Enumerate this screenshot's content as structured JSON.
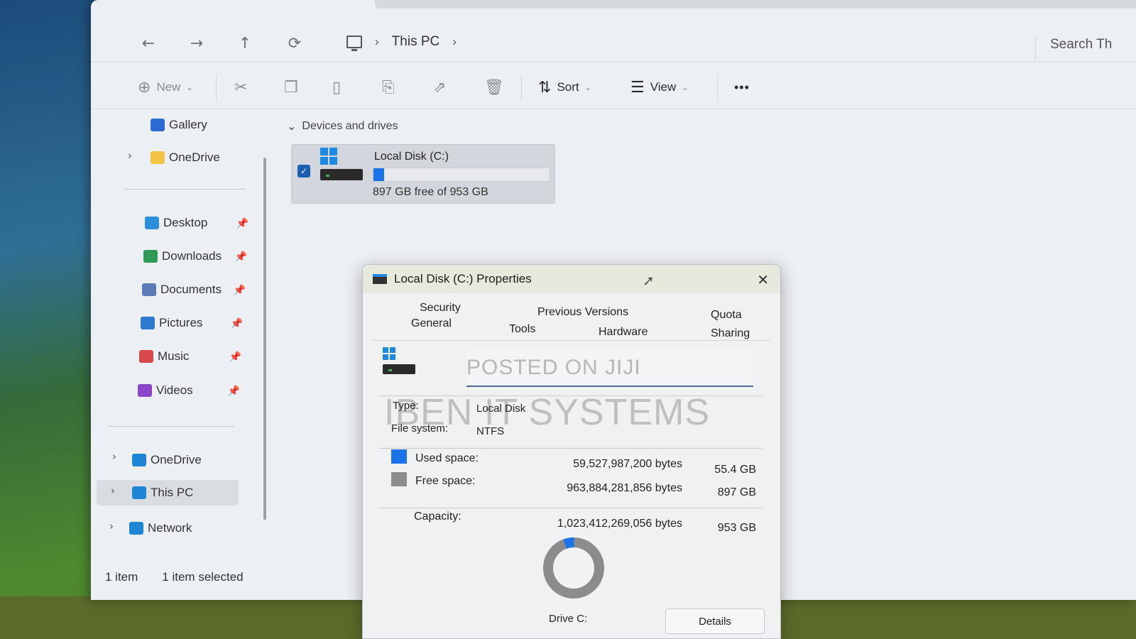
{
  "explorer": {
    "nav": {
      "back": "←",
      "forward": "→",
      "up": "↑",
      "refresh": "⟳"
    },
    "breadcrumb": [
      "This PC"
    ],
    "search_placeholder": "Search Th",
    "toolbar": {
      "new_label": "New",
      "sort_label": "Sort",
      "view_label": "View",
      "more_label": "•••"
    },
    "sidebar": {
      "items": [
        {
          "label": "Gallery",
          "icon": "gallery-icon",
          "color": "#2b6cd4"
        },
        {
          "label": "OneDrive",
          "icon": "folder-icon",
          "color": "#f3c343"
        },
        {
          "label": "Desktop",
          "icon": "desktop-folder-icon",
          "color": "#2a8fd8"
        },
        {
          "label": "Downloads",
          "icon": "downloads-folder-icon",
          "color": "#2e9a55"
        },
        {
          "label": "Documents",
          "icon": "documents-folder-icon",
          "color": "#5a7bb8"
        },
        {
          "label": "Pictures",
          "icon": "pictures-folder-icon",
          "color": "#2f78d0"
        },
        {
          "label": "Music",
          "icon": "music-folder-icon",
          "color": "#d84a4a"
        },
        {
          "label": "Videos",
          "icon": "videos-folder-icon",
          "color": "#8a45c8"
        },
        {
          "label": "OneDrive",
          "icon": "onedrive-icon",
          "color": "#1f86d6"
        },
        {
          "label": "This PC",
          "icon": "this-pc-icon",
          "color": "#1f86d6"
        },
        {
          "label": "Network",
          "icon": "network-icon",
          "color": "#1f86d6"
        }
      ]
    },
    "status": {
      "count": "1 item",
      "selected": "1 item selected"
    },
    "group_header": "Devices and drives",
    "drive_tile": {
      "name": "Local Disk (C:)",
      "free_text": "897 GB free of 953 GB",
      "used_fraction": 0.06
    }
  },
  "dialog": {
    "title": "Local Disk (C:) Properties",
    "close": "✕",
    "tabs": {
      "security": "Security",
      "general": "General",
      "previous_versions": "Previous Versions",
      "tools": "Tools",
      "hardware": "Hardware",
      "quota": "Quota",
      "sharing": "Sharing"
    },
    "label_field_value": "POSTED ON JIJI",
    "watermark": "IBEN IT SYSTEMS",
    "type_label": "Type:",
    "type_value": "Local Disk",
    "fs_label": "File system:",
    "fs_value": "NTFS",
    "used_label": "Used space:",
    "used_bytes": "59,527,987,200 bytes",
    "used_gb": "55.4 GB",
    "free_label": "Free space:",
    "free_bytes": "963,884,281,856 bytes",
    "free_gb": "897 GB",
    "capacity_label": "Capacity:",
    "capacity_bytes": "1,023,412,269,056 bytes",
    "capacity_gb": "953 GB",
    "used_color": "#1a73e8",
    "free_color": "#8c8c8c",
    "used_fraction": 0.058,
    "drive_caption": "Drive C:",
    "details_label": "Details"
  }
}
